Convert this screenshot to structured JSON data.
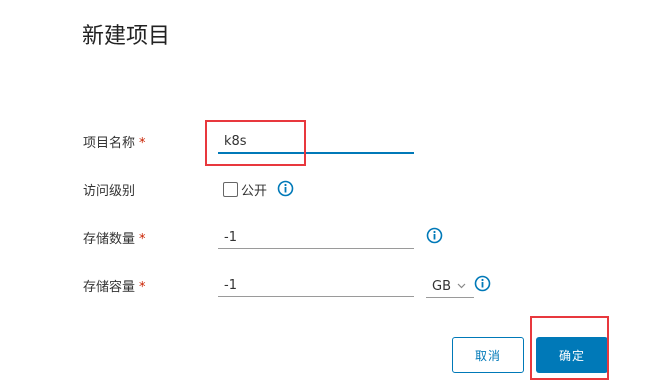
{
  "dialog": {
    "title": "新建项目"
  },
  "form": {
    "project_name": {
      "label": "项目名称",
      "required_mark": "*",
      "value": "k8s"
    },
    "access_level": {
      "label": "访问级别",
      "checkbox_label": "公开",
      "checked": false
    },
    "storage_count": {
      "label": "存储数量",
      "required_mark": "*",
      "value": "-1"
    },
    "storage_capacity": {
      "label": "存储容量",
      "required_mark": "*",
      "value": "-1",
      "unit": "GB"
    }
  },
  "buttons": {
    "cancel": "取消",
    "ok": "确定"
  },
  "colors": {
    "accent": "#0079b8",
    "required": "#c92100",
    "highlight": "#e8383d"
  },
  "icons": {
    "info": "info-circle-icon",
    "chevron": "chevron-down-icon"
  }
}
